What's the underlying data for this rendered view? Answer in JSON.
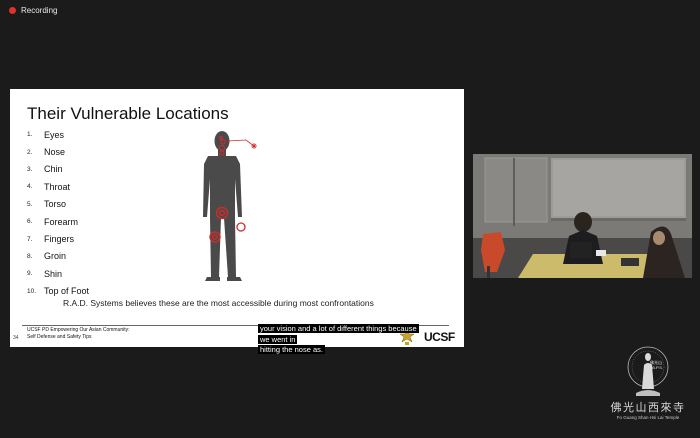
{
  "meeting": {
    "recording_label": "Recording"
  },
  "slide": {
    "title": "Their Vulnerable Locations",
    "items": [
      {
        "num": "1.",
        "label": "Eyes"
      },
      {
        "num": "2.",
        "label": "Nose"
      },
      {
        "num": "3.",
        "label": "Chin"
      },
      {
        "num": "4.",
        "label": "Throat"
      },
      {
        "num": "5.",
        "label": "Torso"
      },
      {
        "num": "6.",
        "label": "Forearm"
      },
      {
        "num": "7.",
        "label": "Fingers"
      },
      {
        "num": "8.",
        "label": "Groin"
      },
      {
        "num": "9.",
        "label": "Shin"
      },
      {
        "num": "10.",
        "label": "Top of Foot"
      }
    ],
    "statement": "R.A.D. Systems believes these are the most accessible during most confrontations",
    "footer_line1": "UCSF PD Empowering Our Asian Community:",
    "footer_line2": "Self Defense and Safety Tips",
    "page_number": "34",
    "brand": "UCSF",
    "target_color": "#d42a2a"
  },
  "caption": {
    "lines": [
      "your vision and a lot of different things because",
      "we went in",
      "hitting the nose as."
    ]
  },
  "watermark": {
    "cn_name": "佛光山西來寺",
    "en_name": "Fo Guang Shan Hsi Lai Temple",
    "small_cn": "佛光山",
    "small_code": "I.B.P.S."
  }
}
